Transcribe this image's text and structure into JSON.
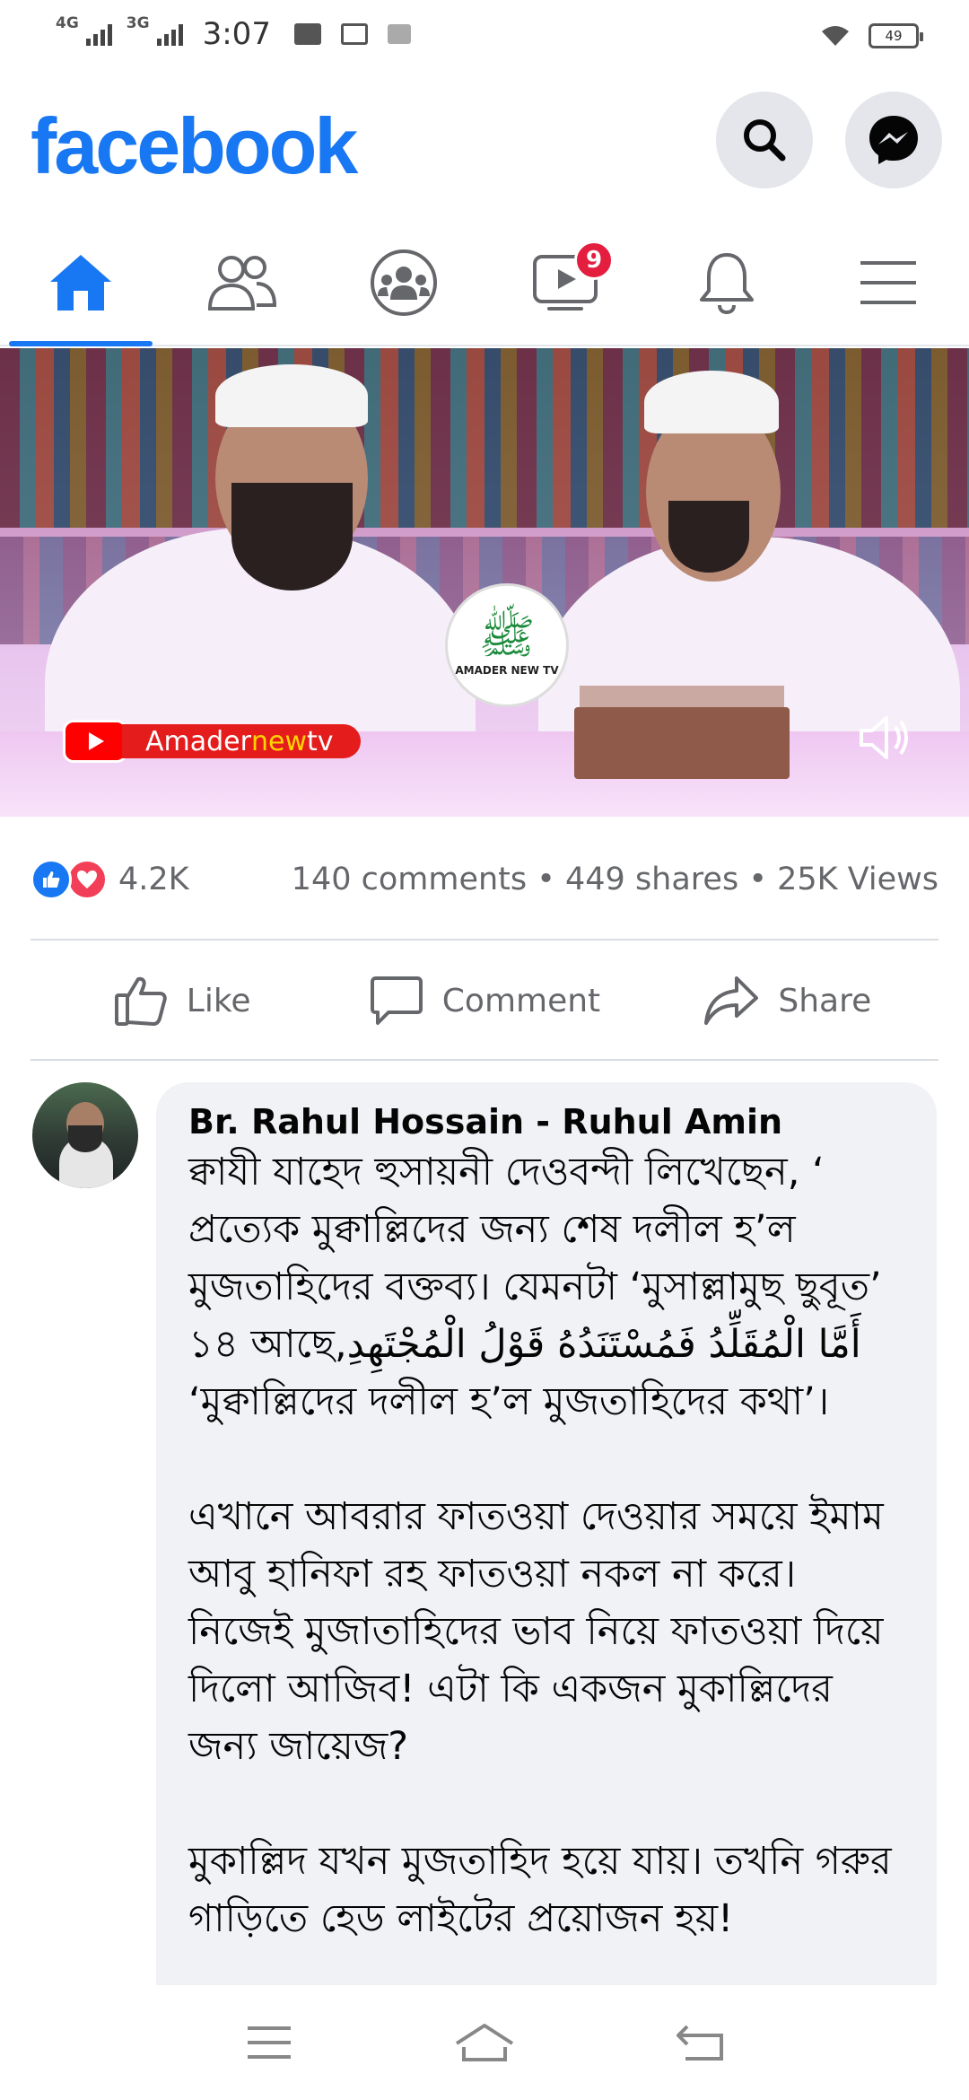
{
  "status_bar": {
    "network_1": "4G",
    "network_2": "3G",
    "time": "3:07",
    "battery": "49",
    "icons": [
      "mail-icon",
      "message-icon",
      "camera-icon",
      "wifi-icon",
      "battery-icon"
    ]
  },
  "header": {
    "logo": "facebook",
    "buttons": [
      "search-icon",
      "messenger-icon"
    ],
    "brand_color": "#1877f2"
  },
  "nav": {
    "tabs": [
      {
        "name": "home",
        "icon": "home-icon",
        "active": true
      },
      {
        "name": "friends",
        "icon": "friends-icon",
        "active": false
      },
      {
        "name": "groups",
        "icon": "groups-icon",
        "active": false
      },
      {
        "name": "watch",
        "icon": "watch-icon",
        "active": false,
        "badge": "9"
      },
      {
        "name": "notifications",
        "icon": "bell-icon",
        "active": false
      },
      {
        "name": "menu",
        "icon": "menu-icon",
        "active": false
      }
    ]
  },
  "video": {
    "channel_badge": {
      "prefix": "Amader",
      "highlight": "new",
      "suffix": "tv"
    },
    "channel_logo_text": "AMADER NEW TV",
    "mute_icon": "volume-muted-icon"
  },
  "reactions": {
    "count": "4.2K",
    "stats": "140 comments • 449 shares • 25K Views",
    "icons": [
      "like-reaction-icon",
      "love-reaction-icon"
    ]
  },
  "actions": {
    "like": "Like",
    "comment": "Comment",
    "share": "Share"
  },
  "comment": {
    "author": "Br. Rahul Hossain - Ruhul Amin",
    "paragraphs": [
      "ক্বাযী যাহেদ হুসায়নী দেওবন্দী লিখেছেন, ‘ প্রত্যেক মুক্বাল্লিদের জন্য শেষ দলীল হ’ল মুজতাহিদের বক্তব্য। যেমনটা ‘মুসাল্লামুছ ছুবূত’ ১৪ আছে,أَمَّا الْمُقَلِّدُ فَمُسْتَنَدُهُ قَوْلُ الْمُجْتَهِدِ ‘মুক্বাল্লিদের দলীল হ’ল মুজতাহিদের কথা’।",
      "এখানে আবরার ফাতওয়া দেওয়ার সময়ে ইমাম আবু হানিফা রহ ফাতওয়া নকল না করে। নিজেই মুজাতাহিদের ভাব নিয়ে ফাতওয়া দিয়ে দিলো আজিব! এটা কি একজন মুকাল্লিদের জন্য জায়েজ?",
      "মুকাল্লিদ যখন মুজতাহিদ হয়ে যায়। তখনি গরুর গাড়িতে হেড লাইটের প্রয়োজন হয়!"
    ]
  },
  "system_nav": [
    "menu-lines-icon",
    "home-outline-icon",
    "back-icon"
  ]
}
